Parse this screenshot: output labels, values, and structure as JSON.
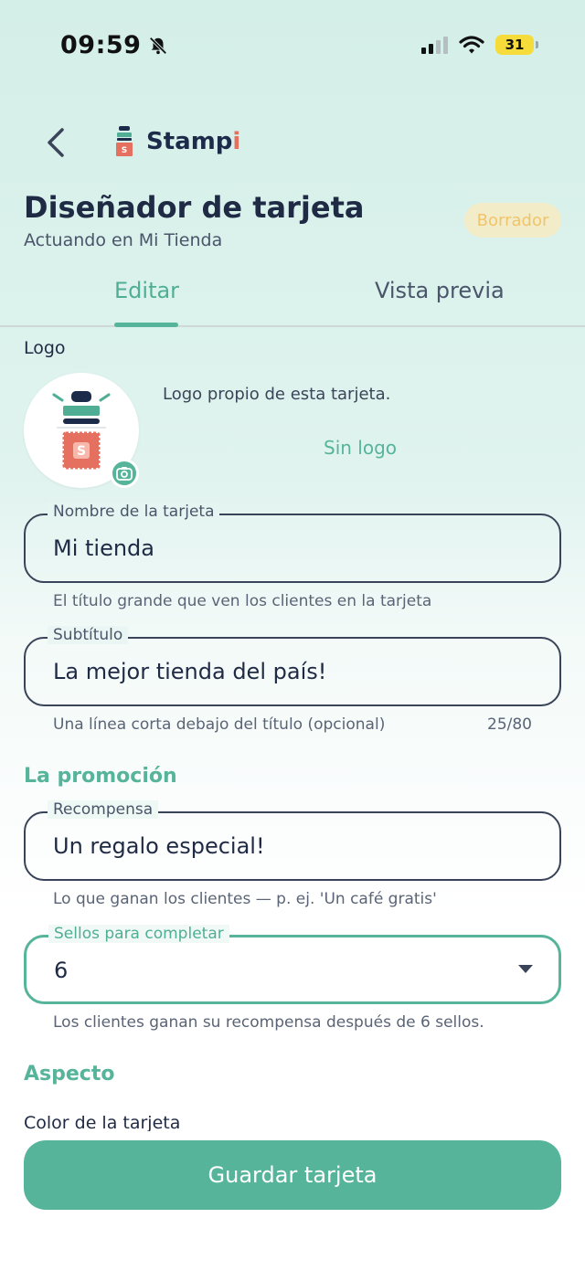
{
  "status": {
    "time": "09:59",
    "battery": "31"
  },
  "brand": {
    "name_main": "Stamp",
    "name_accent": "i"
  },
  "page": {
    "title": "Diseñador de tarjeta",
    "subtitle": "Actuando en Mi Tienda",
    "badge": "Borrador"
  },
  "tabs": [
    {
      "label": "Editar",
      "active": true
    },
    {
      "label": "Vista previa",
      "active": false
    }
  ],
  "logo": {
    "label": "Logo",
    "description": "Logo propio de esta tarjeta.",
    "remove_label": "Sin logo",
    "icon": "camera-icon"
  },
  "card_name": {
    "label": "Nombre de la tarjeta",
    "value": "Mi tienda",
    "helper": "El título grande que ven los clientes en la tarjeta"
  },
  "card_subtitle": {
    "label": "Subtítulo",
    "value": "La mejor tienda del país!",
    "helper": "Una línea corta debajo del título (opcional)",
    "counter": "25/80"
  },
  "promotion": {
    "heading": "La promoción",
    "reward": {
      "label": "Recompensa",
      "value": "Un regalo especial!",
      "helper": "Lo que ganan los clientes — p. ej. 'Un café gratis'"
    },
    "stamps": {
      "label": "Sellos para completar",
      "value": "6",
      "helper": "Los clientes ganan su recompensa después de 6 sellos."
    }
  },
  "appearance": {
    "heading": "Aspecto",
    "color_label": "Color de la tarjeta"
  },
  "actions": {
    "save": "Guardar tarjeta"
  },
  "colors": {
    "accent": "#56b49a",
    "badge_bg": "#f3ecc9",
    "badge_text": "#f0c46a",
    "stamp_red": "#e5705f",
    "navy": "#1d2b4a"
  }
}
